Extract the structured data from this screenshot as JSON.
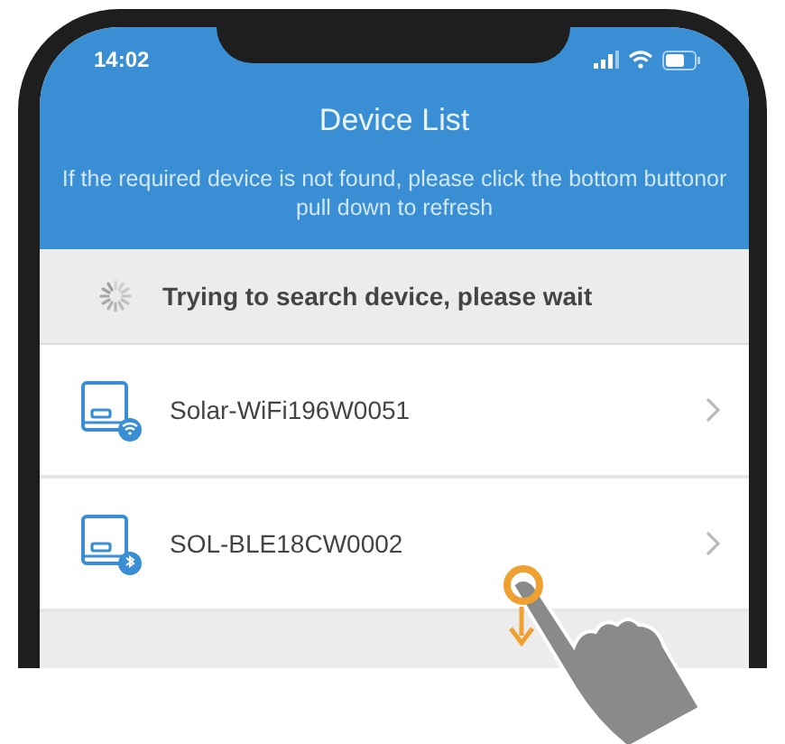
{
  "status_bar": {
    "time": "14:02"
  },
  "header": {
    "title": "Device List",
    "hint": "If the required device is not found, please click the bottom buttonor pull down to refresh"
  },
  "search_status": {
    "text": "Trying to search device, please wait"
  },
  "devices": [
    {
      "name": "Solar-WiFi196W0051",
      "kind": "wifi"
    },
    {
      "name": "SOL-BLE18CW0002",
      "kind": "bluetooth"
    }
  ]
}
